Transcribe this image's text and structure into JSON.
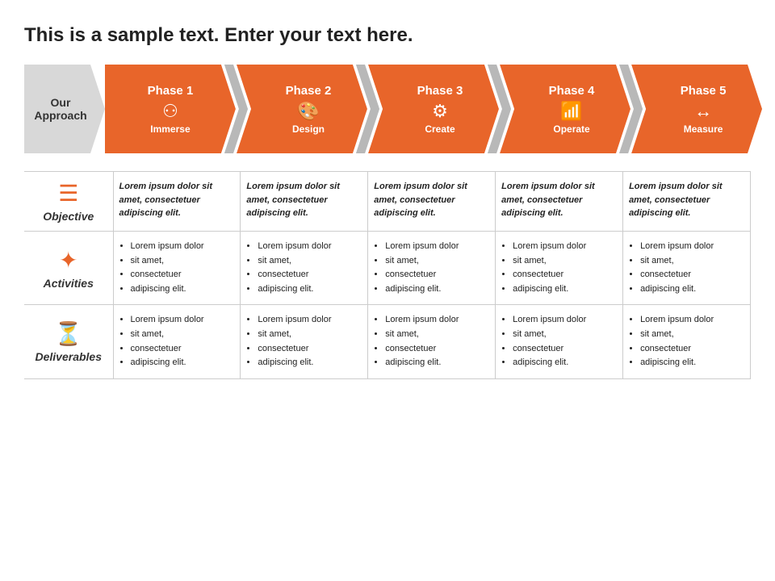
{
  "title": "This is a sample text. Enter your text here.",
  "approach_label": "Our\nApproach",
  "phases": [
    {
      "number": "Phase 1",
      "name": "Immerse",
      "icon": "⚇",
      "color": "orange"
    },
    {
      "number": "Phase 2",
      "name": "Design",
      "icon": "🎨",
      "color": "orange"
    },
    {
      "number": "Phase 3",
      "name": "Create",
      "icon": "⚙",
      "color": "orange"
    },
    {
      "number": "Phase 4",
      "name": "Operate",
      "icon": "📊",
      "color": "orange"
    },
    {
      "number": "Phase 5",
      "name": "Measure",
      "icon": "↔",
      "color": "orange"
    }
  ],
  "rows": [
    {
      "label": "Objective",
      "icon": "checklist",
      "cells": [
        "Lorem ipsum dolor sit amet, consectetuer adipiscing elit.",
        "Lorem ipsum dolor sit amet, consectetuer adipiscing elit.",
        "Lorem ipsum dolor sit amet, consectetuer adipiscing elit.",
        "Lorem ipsum dolor sit amet, consectetuer adipiscing elit.",
        "Lorem ipsum dolor sit amet, consectetuer adipiscing elit."
      ]
    },
    {
      "label": "Activities",
      "icon": "star",
      "cells_bullets": [
        [
          "Lorem ipsum dolor",
          "sit amet,",
          "consectetuer",
          "adipiscing elit."
        ],
        [
          "Lorem ipsum dolor",
          "sit amet,",
          "consectetuer",
          "adipiscing elit."
        ],
        [
          "Lorem ipsum dolor",
          "sit amet,",
          "consectetuer",
          "adipiscing elit."
        ],
        [
          "Lorem ipsum dolor",
          "sit amet,",
          "consectetuer",
          "adipiscing elit."
        ],
        [
          "Lorem ipsum dolor",
          "sit amet,",
          "consectetuer",
          "adipiscing elit."
        ]
      ]
    },
    {
      "label": "Deliverables",
      "icon": "hourglass",
      "cells_bullets": [
        [
          "Lorem ipsum dolor",
          "sit amet,",
          "consectetuer",
          "adipiscing elit."
        ],
        [
          "Lorem ipsum dolor",
          "sit amet,",
          "consectetuer",
          "adipiscing elit."
        ],
        [
          "Lorem ipsum dolor",
          "sit amet,",
          "consectetuer",
          "adipiscing elit."
        ],
        [
          "Lorem ipsum dolor",
          "sit amet,",
          "consectetuer",
          "adipiscing elit."
        ],
        [
          "Lorem ipsum dolor",
          "sit amet,",
          "consectetuer",
          "adipiscing elit."
        ]
      ]
    }
  ],
  "colors": {
    "orange": "#E8652A",
    "gray": "#b0b0b0",
    "text_dark": "#222222",
    "border": "#cccccc"
  }
}
